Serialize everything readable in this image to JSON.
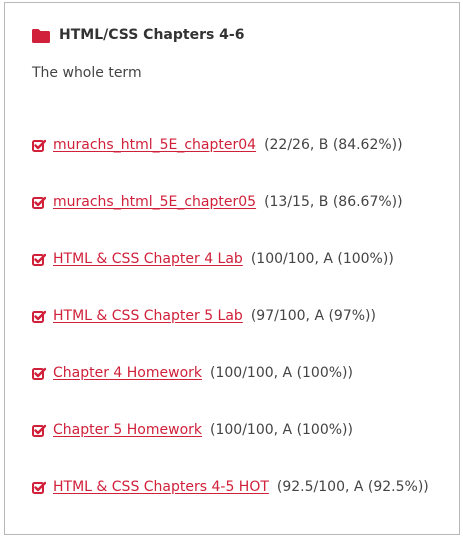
{
  "module": {
    "title": "HTML/CSS Chapters 4-6",
    "subtitle": "The whole term",
    "accent_color": "#d0203a",
    "header_icon": "folder-icon",
    "item_icon": "check-square-icon",
    "items": [
      {
        "label": "murachs_html_5E_chapter04",
        "score": "(22/26, B (84.62%))"
      },
      {
        "label": "murachs_html_5E_chapter05",
        "score": "(13/15, B (86.67%))"
      },
      {
        "label": "HTML & CSS Chapter 4 Lab",
        "score": "(100/100, A (100%))"
      },
      {
        "label": "HTML & CSS Chapter 5 Lab",
        "score": "(97/100, A (97%))"
      },
      {
        "label": "Chapter 4 Homework",
        "score": "(100/100, A (100%))"
      },
      {
        "label": "Chapter 5 Homework",
        "score": "(100/100, A (100%))"
      },
      {
        "label": "HTML & CSS Chapters 4-5 HOT",
        "score": "(92.5/100, A (92.5%))"
      }
    ]
  }
}
